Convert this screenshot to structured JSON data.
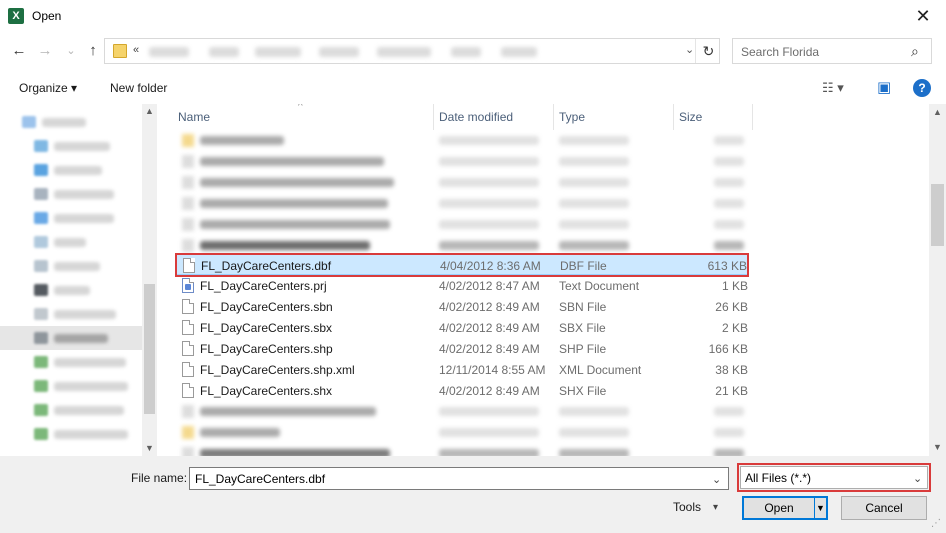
{
  "window": {
    "title": "Open",
    "app_icon": "excel-icon",
    "close_glyph": "✕"
  },
  "nav": {
    "back": "←",
    "forward": "→",
    "recent": "⌄",
    "up": "↑",
    "address_prefix": "«",
    "refresh": "↻",
    "search_placeholder": "Search Florida"
  },
  "toolbar": {
    "organize": "Organize ▾",
    "new_folder": "New folder",
    "view_glyph": "☷ ▾",
    "preview_glyph": "▣",
    "help": "?"
  },
  "columns": {
    "name": "Name",
    "date": "Date modified",
    "type": "Type",
    "size": "Size"
  },
  "files": [
    {
      "name": "FL_DayCareCenters.dbf",
      "date": "4/04/2012 8:36 AM",
      "type": "DBF File",
      "size": "613 KB",
      "icon": "file-icon",
      "selected": true
    },
    {
      "name": "FL_DayCareCenters.prj",
      "date": "4/02/2012 8:47 AM",
      "type": "Text Document",
      "size": "1 KB",
      "icon": "text-file-icon"
    },
    {
      "name": "FL_DayCareCenters.sbn",
      "date": "4/02/2012 8:49 AM",
      "type": "SBN File",
      "size": "26 KB",
      "icon": "file-icon"
    },
    {
      "name": "FL_DayCareCenters.sbx",
      "date": "4/02/2012 8:49 AM",
      "type": "SBX File",
      "size": "2 KB",
      "icon": "file-icon"
    },
    {
      "name": "FL_DayCareCenters.shp",
      "date": "4/02/2012 8:49 AM",
      "type": "SHP File",
      "size": "166 KB",
      "icon": "file-icon"
    },
    {
      "name": "FL_DayCareCenters.shp.xml",
      "date": "12/11/2014 8:55 AM",
      "type": "XML Document",
      "size": "38 KB",
      "icon": "file-icon"
    },
    {
      "name": "FL_DayCareCenters.shx",
      "date": "4/02/2012 8:49 AM",
      "type": "SHX File",
      "size": "21 KB",
      "icon": "file-icon"
    }
  ],
  "footer": {
    "file_name_label": "File name:",
    "file_name_value": "FL_DayCareCenters.dbf",
    "filter_value": "All Files (*.*)",
    "tools": "Tools",
    "open": "Open",
    "cancel": "Cancel"
  },
  "colors": {
    "accent": "#0078d7",
    "highlight": "#d93b3b",
    "selection": "#cce8ff"
  }
}
